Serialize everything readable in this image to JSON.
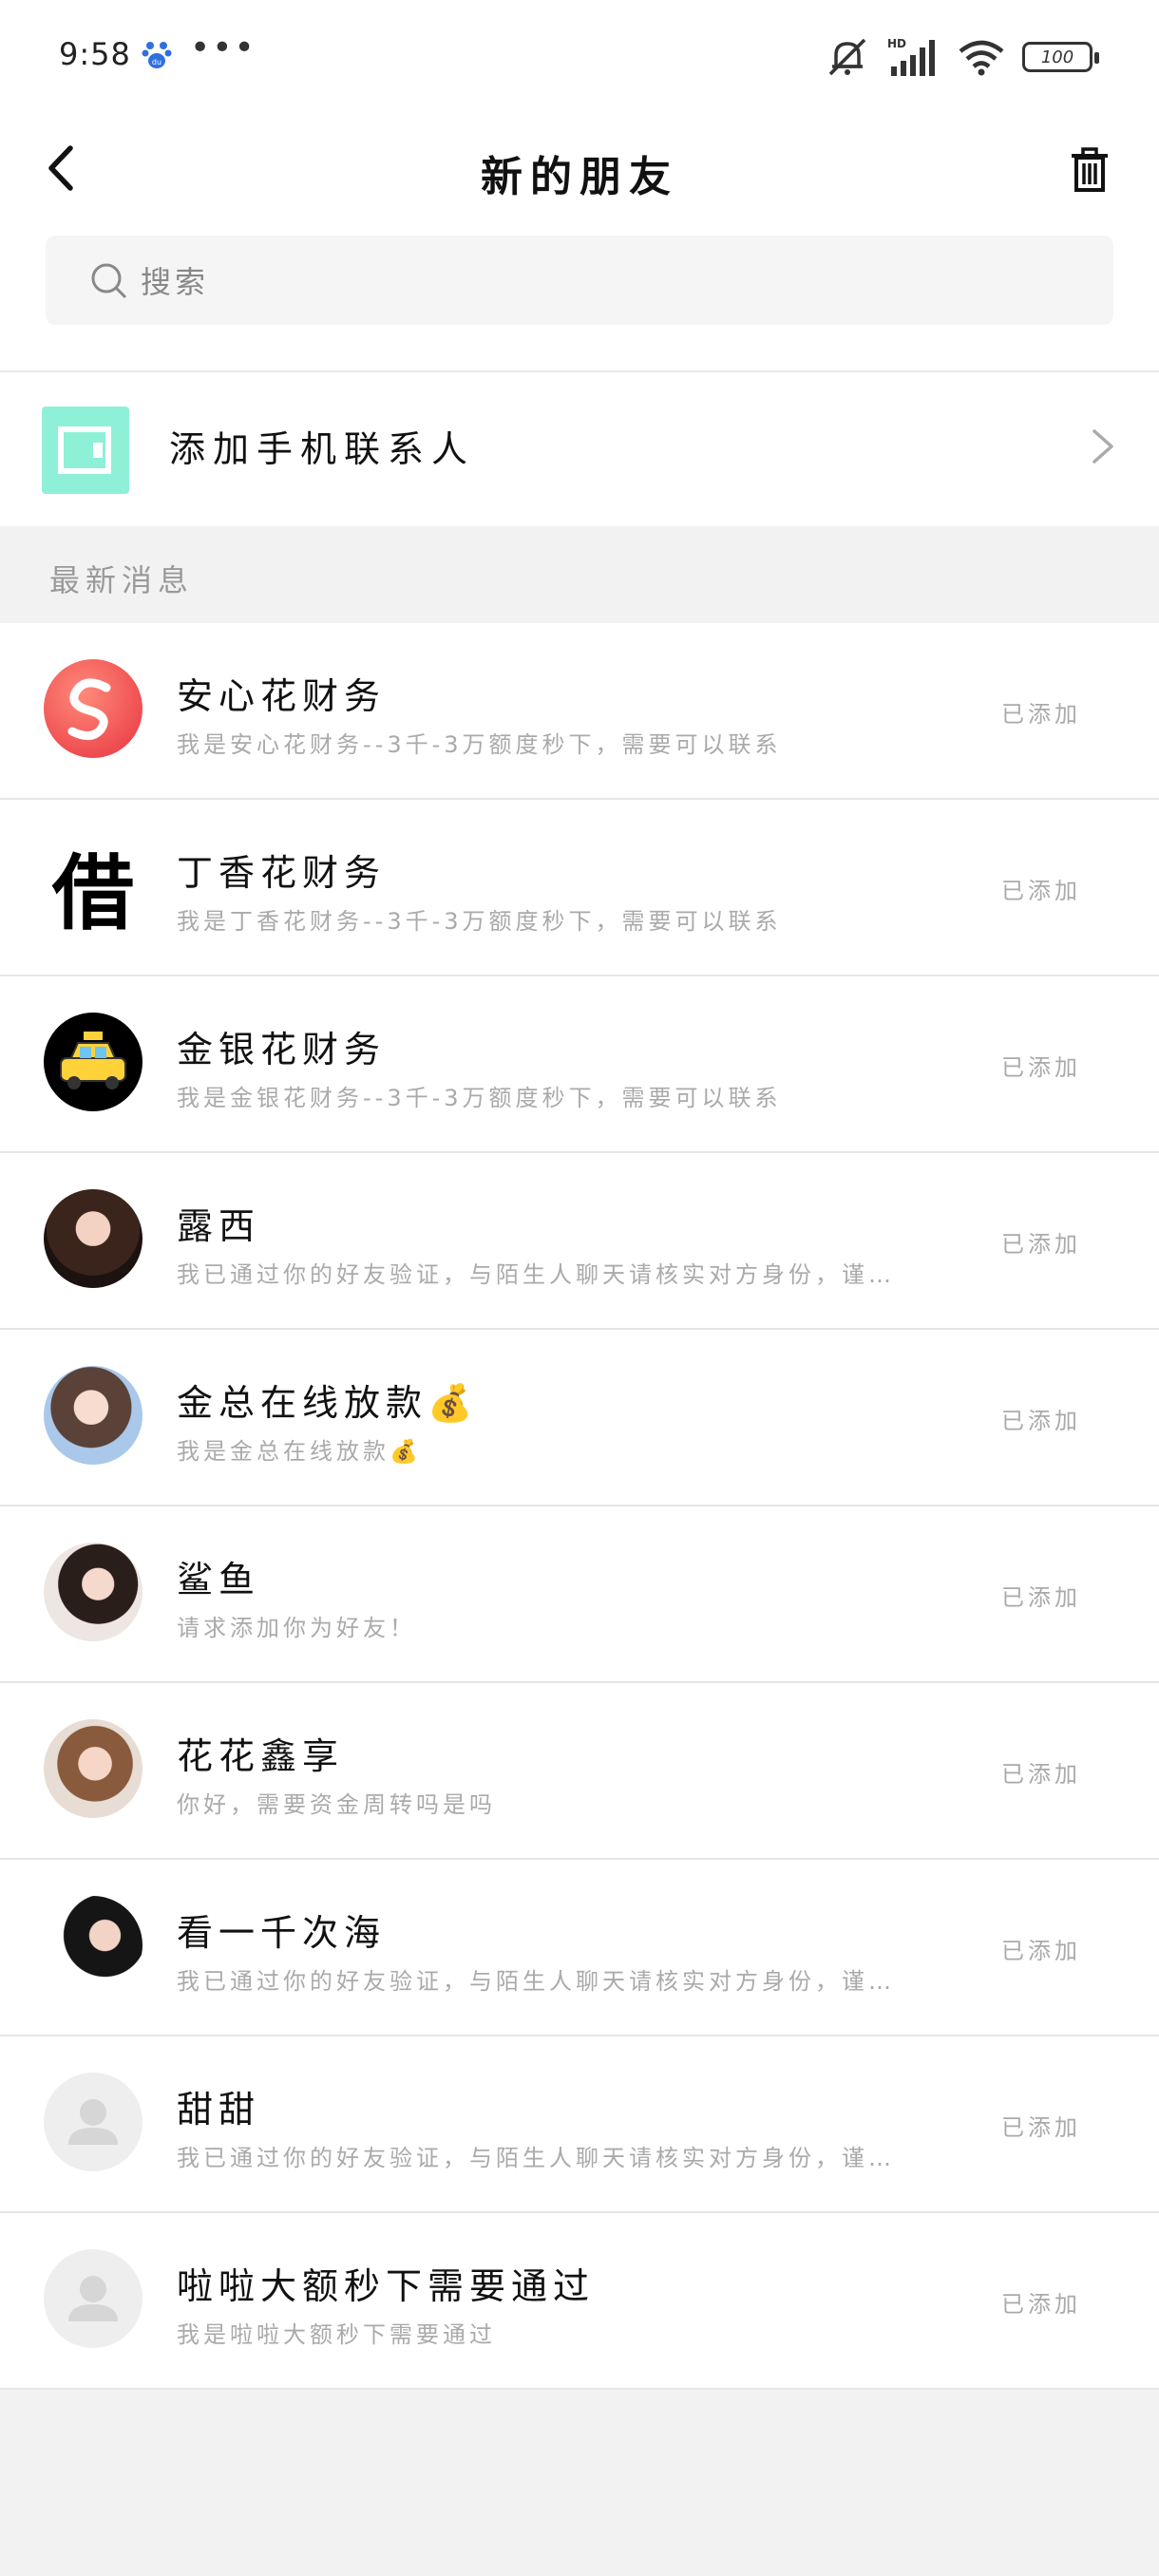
{
  "status_bar": {
    "time": "9:58",
    "dots": "•••",
    "battery": "100",
    "network_label": "HD"
  },
  "header": {
    "title": "新的朋友"
  },
  "search": {
    "placeholder": "搜索"
  },
  "add_contacts": {
    "label": "添加手机联系人",
    "icon_color": "#8ff0d8"
  },
  "section": {
    "label": "最新消息"
  },
  "friends": [
    {
      "name": "安心花财务",
      "message": "我是安心花财务--3千-3万额度秒下，需要可以联系",
      "status": "已添加",
      "avatar": "logo-s-icon"
    },
    {
      "name": "丁香花财务",
      "message": "我是丁香花财务--3千-3万额度秒下，需要可以联系",
      "status": "已添加",
      "avatar": "借",
      "avatar_type": "character"
    },
    {
      "name": "金银花财务",
      "message": "我是金银花财务--3千-3万额度秒下，需要可以联系",
      "status": "已添加",
      "avatar": "taxi-icon"
    },
    {
      "name": "露西",
      "message": "我已通过你的好友验证，与陌生人聊天请核实对方身份，谨…",
      "status": "已添加",
      "avatar": "photo"
    },
    {
      "name": "金总在线放款💰",
      "message": "我是金总在线放款💰",
      "status": "已添加",
      "avatar": "photo"
    },
    {
      "name": "鲨鱼",
      "message": "请求添加你为好友！",
      "status": "已添加",
      "avatar": "photo"
    },
    {
      "name": "花花鑫享",
      "message": "你好，需要资金周转吗是吗",
      "status": "已添加",
      "avatar": "photo"
    },
    {
      "name": "看一千次海",
      "message": "我已通过你的好友验证，与陌生人聊天请核实对方身份，谨…",
      "status": "已添加",
      "avatar": "photo"
    },
    {
      "name": "甜甜",
      "message": "我已通过你的好友验证，与陌生人聊天请核实对方身份，谨…",
      "status": "已添加",
      "avatar": "default-user-icon"
    },
    {
      "name": "啦啦大额秒下需要通过",
      "message": "我是啦啦大额秒下需要通过",
      "status": "已添加",
      "avatar": "default-user-icon"
    }
  ]
}
